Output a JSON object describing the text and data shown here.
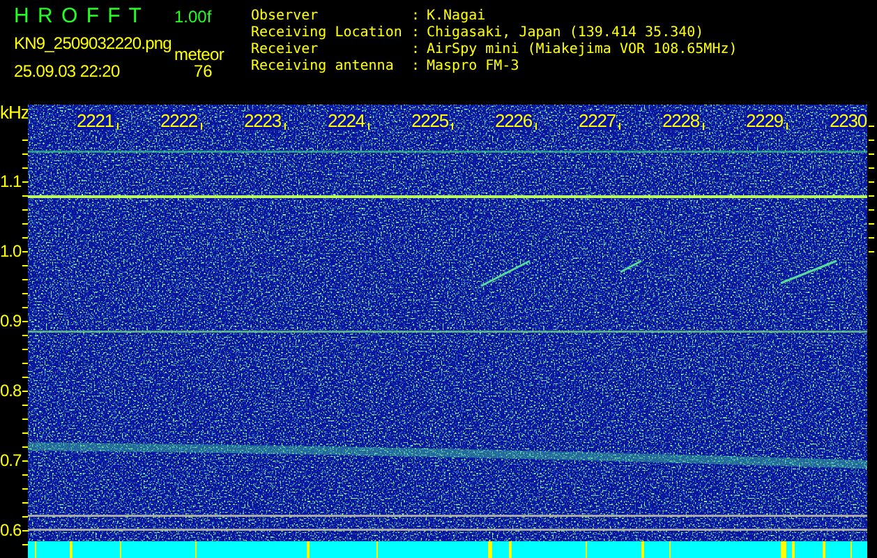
{
  "header": {
    "title": "H R O F F T",
    "version": "1.00f",
    "filename": "KN9_2509032220.png",
    "datetime": "25.09.03 22:20",
    "count_label": "meteor",
    "count": "76",
    "info": [
      {
        "label": "Observer",
        "separator": ":",
        "value": "K.Nagai"
      },
      {
        "label": "Receiving Location",
        "separator": ":",
        "value": "Chigasaki, Japan (139.414 35.340)"
      },
      {
        "label": "Receiver",
        "separator": ":",
        "value": "AirSpy mini (Miakejima VOR 108.65MHz)"
      },
      {
        "label": "Receiving antenna",
        "separator": ":",
        "value": "Maspro FM-3"
      }
    ]
  },
  "spectrogram": {
    "unit": "kHz",
    "freq_labels": [
      "1.1",
      "1.0",
      "0.9",
      "0.8",
      "0.7",
      "0.6"
    ],
    "time_labels": [
      "2221",
      "2222",
      "2223",
      "2224",
      "2225",
      "2226",
      "2227",
      "2228",
      "2229",
      "2230"
    ]
  }
}
